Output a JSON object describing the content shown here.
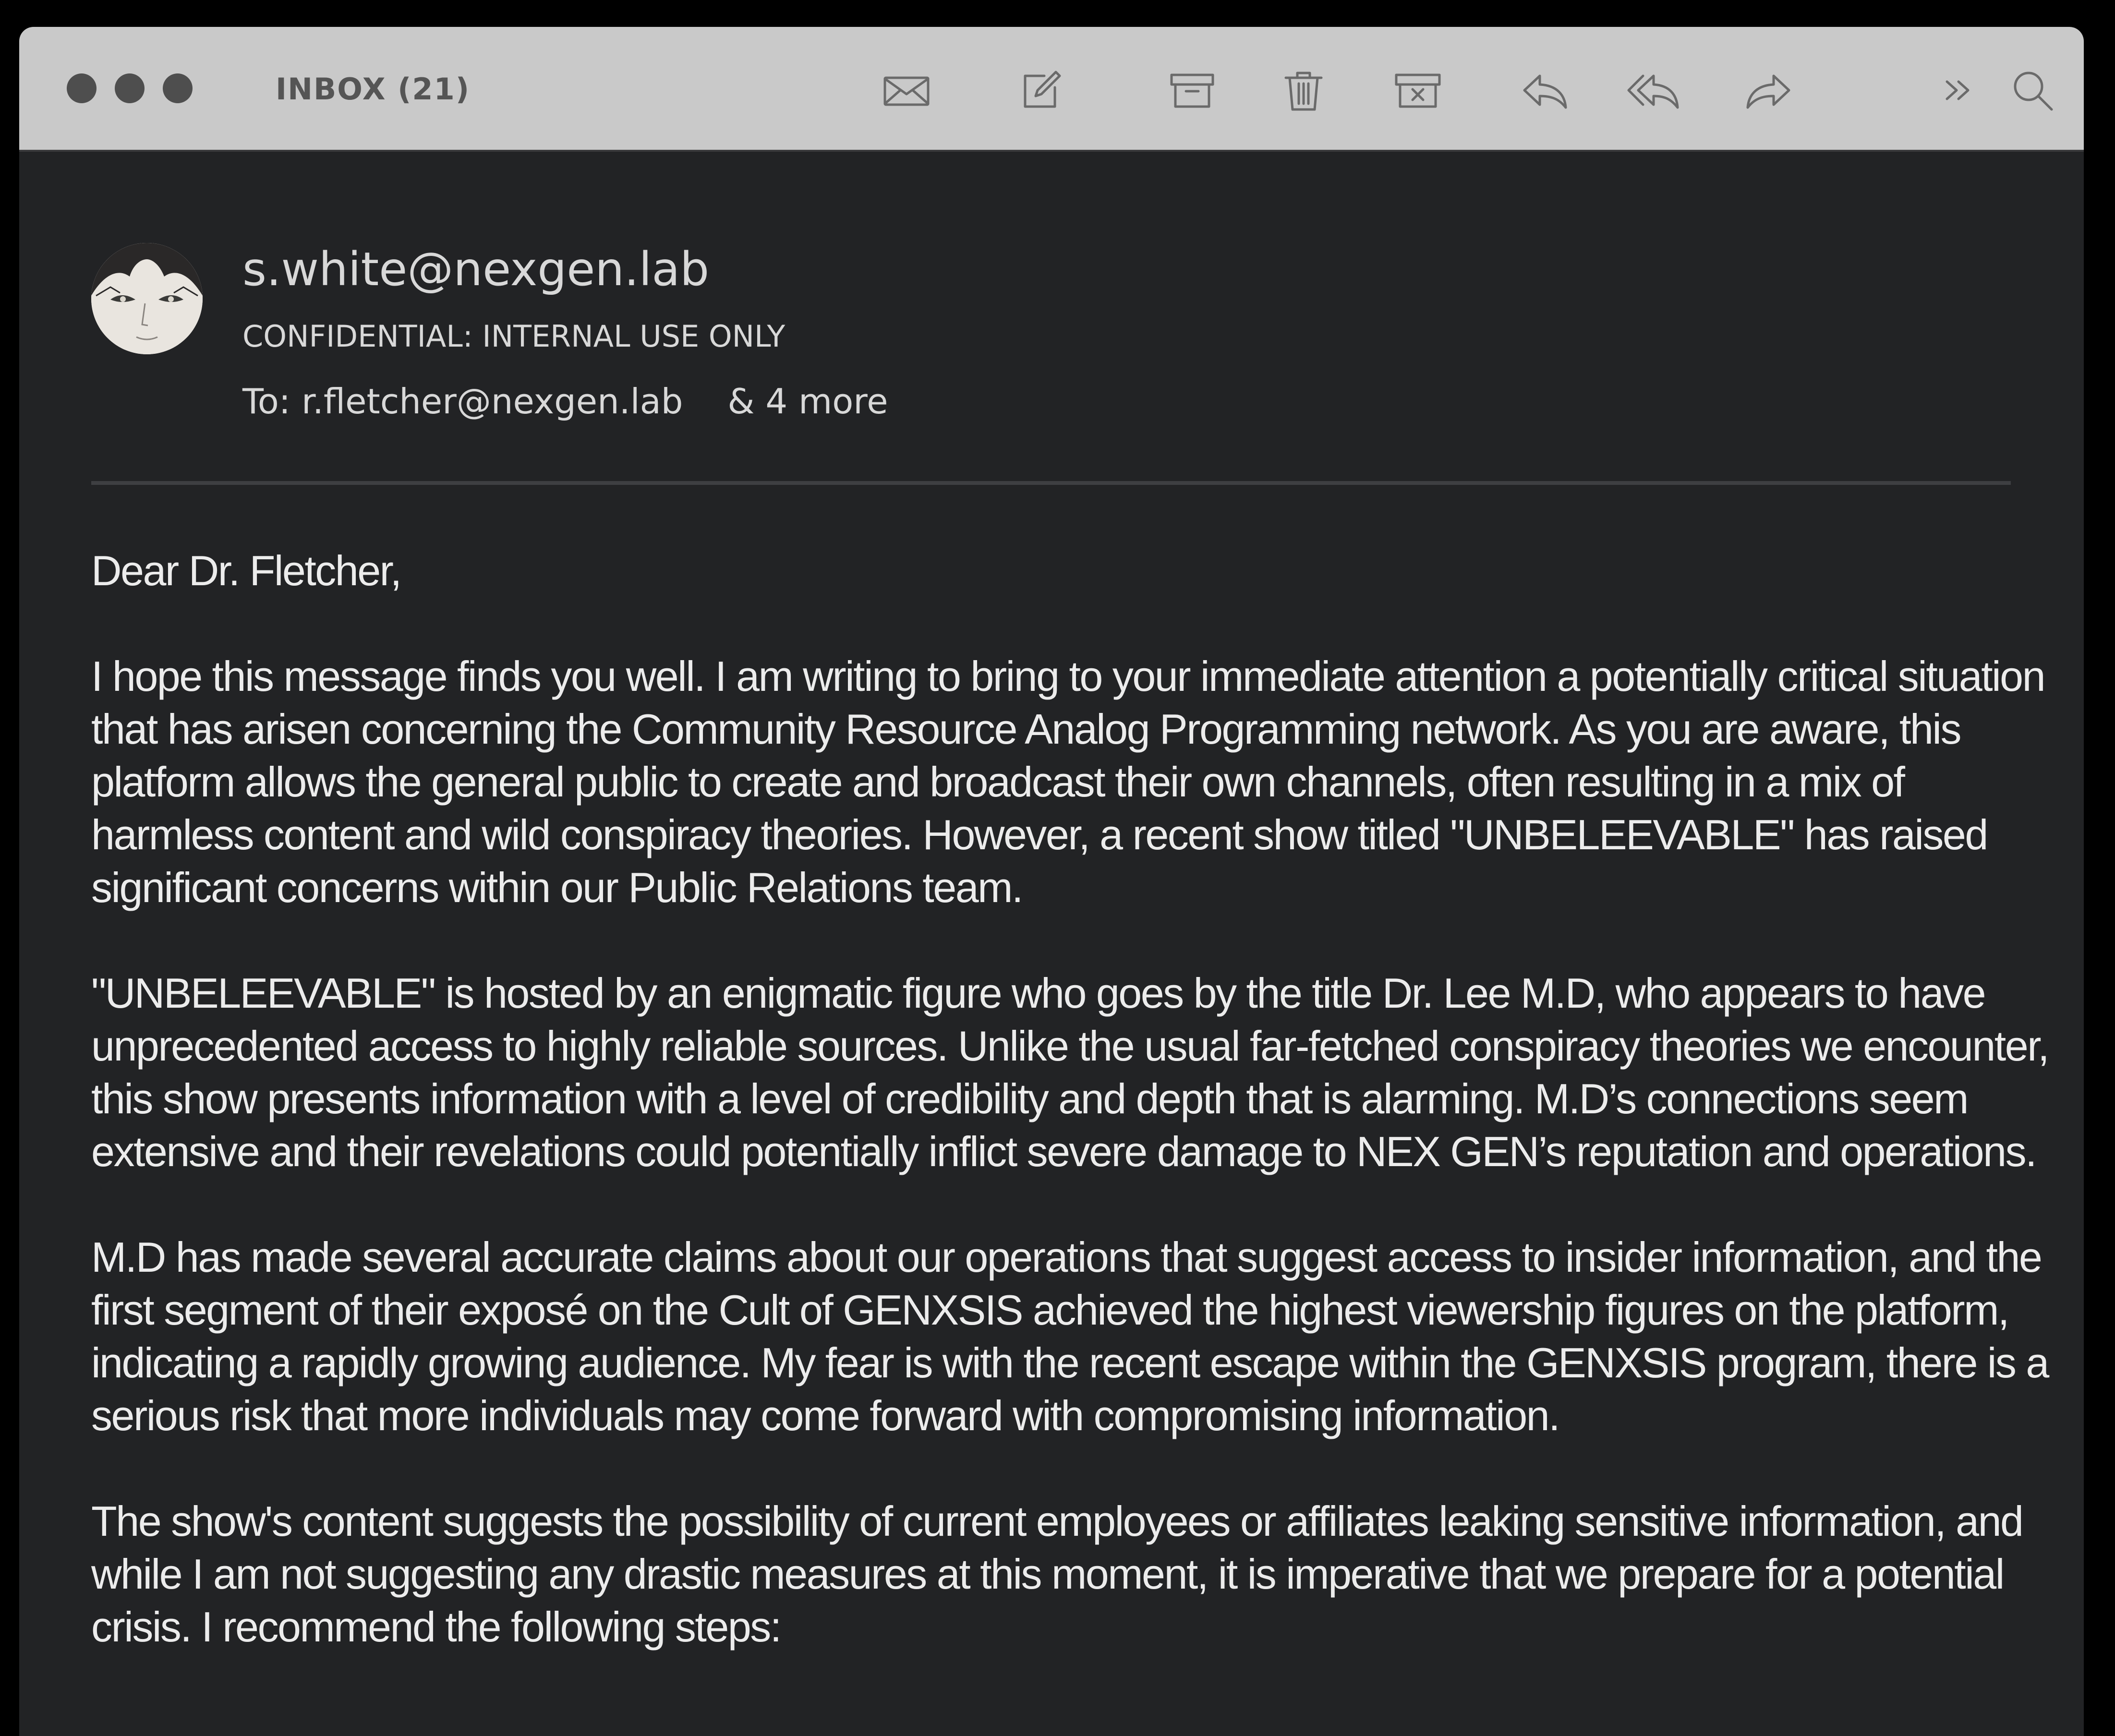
{
  "toolbar": {
    "title": "INBOX (21)",
    "icons": [
      "mail-icon",
      "compose-icon",
      "archive-icon",
      "trash-icon",
      "junk-icon",
      "reply-icon",
      "reply-all-icon",
      "forward-icon",
      "more-icon",
      "search-icon"
    ]
  },
  "message": {
    "sender": "s.white@nexgen.lab",
    "subject": "CONFIDENTIAL: INTERNAL USE ONLY",
    "to_label": "To:",
    "to": "r.fletcher@nexgen.lab",
    "more": "& 4 more",
    "body": [
      "Dear Dr. Fletcher,",
      "I hope this message finds you well. I am writing to bring to your immediate attention a potentially critical situation that has arisen concerning the Community Resource Analog Programming network. As you are aware, this platform allows the general public to create and broadcast their own channels, often resulting in a mix of harmless content and wild conspiracy theories. However, a recent show titled \"UNBELEEVABLE\" has raised significant concerns within our Public Relations team.",
      "\"UNBELEEVABLE\" is hosted by an enigmatic figure who goes by the title Dr. Lee M.D, who appears to have unprecedented access to highly reliable sources. Unlike the usual far-fetched conspiracy theories we encounter, this show presents information with a level of credibility and depth that is alarming. M.D’s connections seem extensive and their revelations could potentially inflict severe damage to NEX GEN’s reputation and operations.",
      "M.D has made several accurate claims about our operations that suggest access to insider information, and the first segment of their exposé on the Cult of GENXSIS achieved the highest viewership figures on the platform, indicating a rapidly growing audience. My fear is with the recent escape within the GENXSIS program, there is a serious risk that more individuals may come forward with compromising information.",
      "The show's content suggests the possibility of current employees or affiliates leaking sensitive information, and while I am not suggesting any drastic measures at this moment, it is imperative that we prepare for a potential crisis. I recommend the following steps:"
    ]
  },
  "colors": {
    "toolbar_bg": "#c9c9c9",
    "window_bg": "#222325",
    "text": "#ececec",
    "icon": "#6a6a6a"
  }
}
